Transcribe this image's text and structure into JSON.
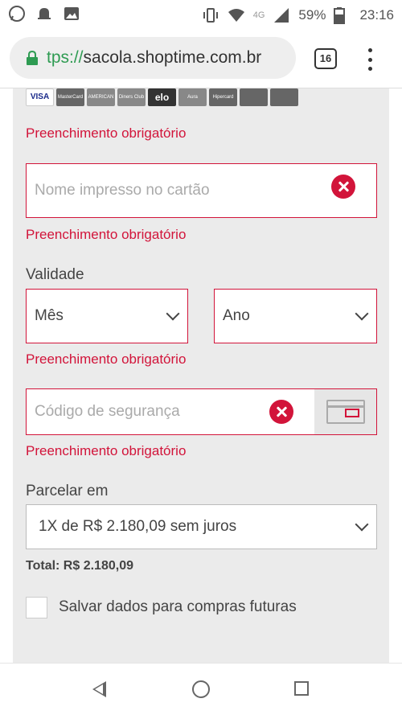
{
  "status_bar": {
    "network": "4G",
    "battery": "59%",
    "time": "23:16"
  },
  "browser": {
    "url_scheme": "tps://",
    "url_host": "sacola.shoptime.com.br",
    "tab_count": "16"
  },
  "payment": {
    "card_brands": [
      "VISA",
      "MasterCard",
      "AMERICAN EXPRESS",
      "Diners Club",
      "elo",
      "Aura",
      "Hipercard",
      "",
      ""
    ],
    "brand_error": "Preenchimento obrigatório",
    "name_placeholder": "Nome impresso no cartão",
    "name_error": "Preenchimento obrigatório",
    "validity_label": "Validade",
    "month_value": "Mês",
    "year_value": "Ano",
    "validity_error": "Preenchimento obrigatório",
    "cvv_placeholder": "Código de segurança",
    "cvv_error": "Preenchimento obrigatório",
    "installments_label": "Parcelar em",
    "installments_value": "1X de R$ 2.180,09 sem juros",
    "total": "Total: R$ 2.180,09",
    "save_label": "Salvar dados para compras futuras"
  },
  "colors": {
    "error": "#d2143a",
    "panel": "#ebebeb",
    "secure": "#2e9b52"
  }
}
